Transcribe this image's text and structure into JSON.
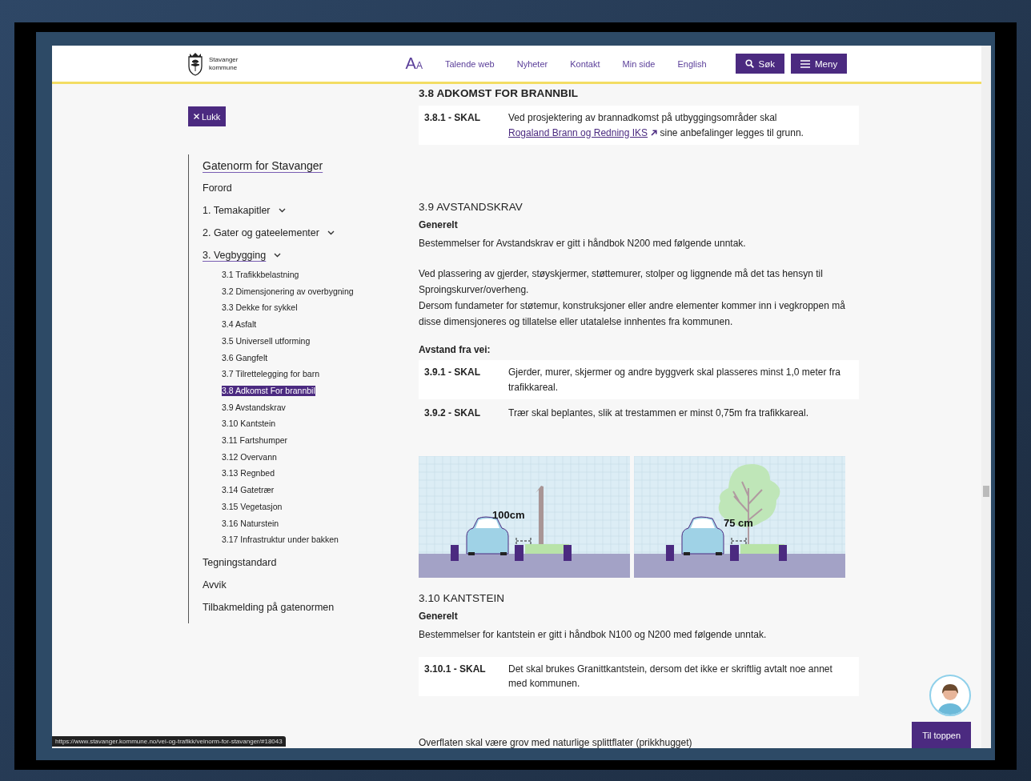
{
  "header": {
    "logo_lines": [
      "Stavanger",
      "kommune"
    ],
    "text_size": {
      "large": "A",
      "small": "A"
    },
    "nav_links": [
      "Talende web",
      "Nyheter",
      "Kontakt",
      "Min side",
      "English"
    ],
    "search_button": "Søk",
    "menu_button": "Meny"
  },
  "close_button": "Lukk",
  "toc": {
    "title": {
      "label": "Gatenorm for Stavanger",
      "current": true
    },
    "items": [
      {
        "label": "Forord",
        "kind": "link",
        "current": false
      },
      {
        "label": "1. Temakapitler",
        "kind": "chapter",
        "current": false
      },
      {
        "label": "2. Gater og gateelementer",
        "kind": "chapter",
        "current": false
      },
      {
        "label": "3. Vegbygging",
        "kind": "chapter",
        "current": true,
        "children": [
          {
            "label": "3.1 Trafikkbelastning",
            "selected": false
          },
          {
            "label": "3.2 Dimensjonering av overbygning",
            "selected": false
          },
          {
            "label": "3.3 Dekke for sykkel",
            "selected": false
          },
          {
            "label": "3.4 Asfalt",
            "selected": false
          },
          {
            "label": "3.5 Universell utforming",
            "selected": false
          },
          {
            "label": "3.6 Gangfelt",
            "selected": false
          },
          {
            "label": "3.7 Tilrettelegging for barn",
            "selected": false
          },
          {
            "label": "3.8 Adkomst For brannbil",
            "selected": true
          },
          {
            "label": "3.9 Avstandskrav",
            "selected": false
          },
          {
            "label": "3.10 Kantstein",
            "selected": false
          },
          {
            "label": "3.11 Fartshumper",
            "selected": false
          },
          {
            "label": "3.12 Overvann",
            "selected": false
          },
          {
            "label": "3.13 Regnbed",
            "selected": false
          },
          {
            "label": "3.14 Gatetrær",
            "selected": false
          },
          {
            "label": "3.15 Vegetasjon",
            "selected": false
          },
          {
            "label": "3.16 Naturstein",
            "selected": false
          },
          {
            "label": "3.17 Infrastruktur under bakken",
            "selected": false
          }
        ]
      },
      {
        "label": "Tegningstandard",
        "kind": "link",
        "current": false
      },
      {
        "label": "Avvik",
        "kind": "link",
        "current": false
      },
      {
        "label": "Tilbakmelding på gatenormen",
        "kind": "link",
        "current": false
      }
    ]
  },
  "sections": [
    {
      "heading": "3.8 ADKOMST FOR BRANNBIL",
      "blocks": [
        {
          "kind": "requirement",
          "code": "3.8.1 - SKAL",
          "text": "Ved prosjektering av brannadkomst på utbyggingsområder skal",
          "link": "Rogaland Brann og Redning IKS",
          "text_after": "sine anbefalinger legges til grunn."
        }
      ]
    },
    {
      "heading": "3.9 AVSTANDSKRAV",
      "blocks": [
        {
          "kind": "subheading",
          "text": "Generelt"
        },
        {
          "kind": "paragraph",
          "text": "Bestemmelser for Avstandskrav er gitt i håndbok N200 med følgende unntak."
        },
        {
          "kind": "paragraph",
          "text": "Ved plassering av gjerder, støyskjermer, støttemurer, stolper og liggnende må det tas hensyn til Sproingskurver/overheng.\nDersom fundameter for støtemur, konstruksjoner eller andre elementer kommer inn i vegkroppen må disse dimensjoneres og tillatelse eller utatalelse innhentes fra kommunen."
        },
        {
          "kind": "subheading",
          "text": "Avstand fra vei:"
        },
        {
          "kind": "requirement",
          "code": "3.9.1 - SKAL",
          "text": "Gjerder, murer, skjermer og andre byggverk skal plasseres minst 1,0 meter fra trafikkareal."
        },
        {
          "kind": "requirement",
          "code": "3.9.2 - SKAL",
          "text": "Trær skal beplantes, slik at trestammen er minst 0,75m fra trafikkareal."
        },
        {
          "kind": "figure",
          "panels": [
            {
              "kind": "post",
              "label": "100cm"
            },
            {
              "kind": "tree",
              "label": "75 cm"
            }
          ]
        }
      ]
    },
    {
      "heading": "3.10 KANTSTEIN",
      "blocks": [
        {
          "kind": "subheading",
          "text": "Generelt"
        },
        {
          "kind": "paragraph",
          "text": "Bestemmelser for kantstein er gitt i håndbok N100 og N200 med følgende unntak."
        },
        {
          "kind": "requirement",
          "code": "3.10.1 - SKAL",
          "text": "Det skal brukes Granittkantstein, dersom det ikke er skriftlig avtalt noe annet med kommunen."
        },
        {
          "kind": "paragraph",
          "text": "Overflaten skal være grov med naturlige splittflater (prikkhugget)"
        }
      ]
    }
  ],
  "to_top_button": "Til toppen",
  "status_url": "https://www.stavanger.kommune.no/vei-og-trafikk/veinorm-for-stavanger/#18043"
}
